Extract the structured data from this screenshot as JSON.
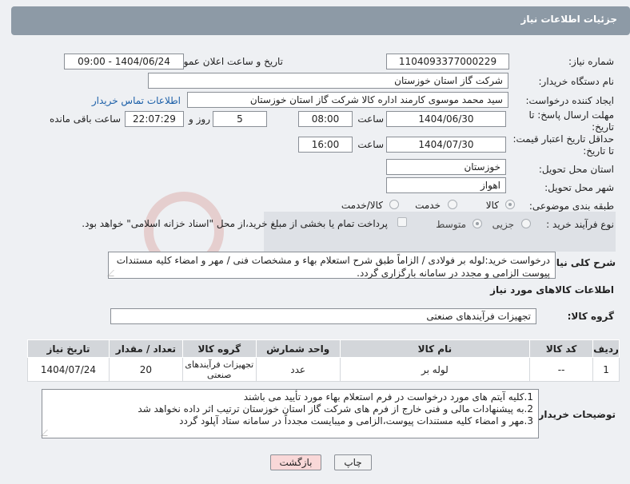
{
  "header": {
    "title": "جزئیات اطلاعات نیاز"
  },
  "form": {
    "need_number_label": "شماره نیاز:",
    "need_number": "1104093377000229",
    "announce_label": "تاریخ و ساعت اعلان عمومی:",
    "announce_value": "1404/06/24 - 09:00",
    "buyer_org_label": "نام دستگاه خریدار:",
    "buyer_org": "شرکت گاز استان خوزستان",
    "creator_label": "ایجاد کننده درخواست:",
    "creator": "سید محمد موسوی کارمند اداره کالا شرکت گاز استان خوزستان",
    "contact_link": "اطلاعات تماس خریدار",
    "reply_deadline_label_1": "مهلت ارسال پاسخ: تا",
    "reply_deadline_label_2": "تاریخ:",
    "reply_date": "1404/06/30",
    "time_label": "ساعت",
    "reply_time": "08:00",
    "days_value": "5",
    "days_label": "روز و",
    "remaining_time": "22:07:29",
    "remaining_label": "ساعت باقی مانده",
    "price_validity_label_1": "حداقل تاریخ اعتبار قیمت:",
    "price_validity_label_2": "تا تاریخ:",
    "price_validity_date": "1404/07/30",
    "price_validity_time": "16:00",
    "province_label": "استان محل تحویل:",
    "province": "خوزستان",
    "city_label": "شهر محل تحویل:",
    "city": "اهواز",
    "category_label": "طبقه بندی موضوعی:",
    "category_options": [
      "کالا",
      "خدمت",
      "کالا/خدمت"
    ],
    "process_label": "نوع فرآیند خرید :",
    "process_options": [
      "جزیی",
      "متوسط"
    ],
    "payment_note": "پرداخت تمام یا بخشی از مبلغ خرید،از محل \"اسناد خزانه اسلامی\" خواهد بود.",
    "description_label": "شرح کلی نیاز:",
    "description": "درخواست خرید:لوله بر فولادی / الزاماً طبق شرح استعلام بهاء و مشخصات فنی / مهر و امضاء کلیه مستندات پیوست الزامی و مجدد در سامانه بارگزاری گردد."
  },
  "goods": {
    "section_title": "اطلاعات کالاهای مورد نیاز",
    "group_label": "گروه کالا:",
    "group_value": "تجهیزات فرآیندهای صنعتی",
    "columns": [
      "ردیف",
      "کد کالا",
      "نام کالا",
      "واحد شمارش",
      "گروه کالا",
      "تعداد / مقدار",
      "تاریخ نیاز"
    ],
    "rows": [
      {
        "row": "1",
        "code": "--",
        "name": "لوله بر",
        "unit": "عدد",
        "group": "تجهیزات فرآیندهای صنعتی",
        "qty": "20",
        "date": "1404/07/24"
      }
    ]
  },
  "buyer_notes": {
    "label": "توضیحات خریدار:",
    "lines": [
      "1.کلیه آیتم های مورد درخواست در فرم استعلام بهاء مورد تأیید می باشند",
      "2.به پیشنهادات مالی و فنی خارج از فرم های شرکت گاز استان خوزستان ترتیب اثر داده نخواهد شد",
      "3.مهر و امضاء کلیه مستندات پیوست،الزامی و میبایست مجدداً در سامانه ستاد آپلود گردد"
    ]
  },
  "buttons": {
    "print": "چاپ",
    "back": "بازگشت"
  },
  "colors": {
    "header": "#8d9aa6",
    "link": "#1b5fa8",
    "back_button": "#f9d8d8",
    "print_button": "#f1f2f3"
  }
}
